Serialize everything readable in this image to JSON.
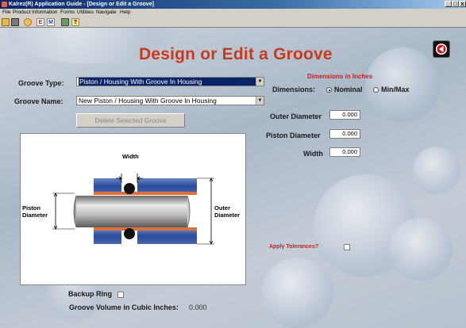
{
  "window": {
    "title": "Kalrez(R) Application Guide - [Design or Edit a Groove]",
    "controls": [
      "_",
      "□",
      "x"
    ]
  },
  "menu": [
    "File",
    "Product",
    "Information",
    "Forms",
    "Utilities",
    "Navigate",
    "Help"
  ],
  "toolbar": {
    "letter_e": "E",
    "letter_m": "M",
    "help_glyph": "?"
  },
  "page": {
    "title": "Design or Edit a Groove"
  },
  "groove_type": {
    "label": "Groove Type:",
    "value": "Piston / Housing With Groove In Housing"
  },
  "groove_name": {
    "label": "Groove Name:",
    "value": "New Piston / Housing With Groove In Housing"
  },
  "delete_button": "Delete Selected Groove",
  "dimensions": {
    "header": "Dimensions in Inches",
    "label": "Dimensions:",
    "nominal": "Nominal",
    "minmax": "Min/Max",
    "selected": "Nominal",
    "outer_diameter": {
      "label": "Outer Diameter",
      "value": "0.000"
    },
    "piston_diameter": {
      "label": "Piston Diameter",
      "value": "0.000"
    },
    "width": {
      "label": "Width",
      "value": "0.000"
    }
  },
  "diagram": {
    "width": "Width",
    "piston_l1": "Piston",
    "piston_l2": "Diameter",
    "outer_l1": "Outer",
    "outer_l2": "Diameter"
  },
  "tolerances": {
    "label": "Apply Tolerances?",
    "checked": false
  },
  "backup_ring": {
    "label": "Backup Ring",
    "checked": false
  },
  "groove_volume": {
    "label": "Groove Volume in Cubic Inches:",
    "value": "0.000"
  },
  "colors": {
    "title_red": "#c83a1e",
    "accent_red": "#c81e1e",
    "titlebar_blue": "#0a246a",
    "housing_blue": "#3a58a8",
    "oring_black": "#111111"
  }
}
